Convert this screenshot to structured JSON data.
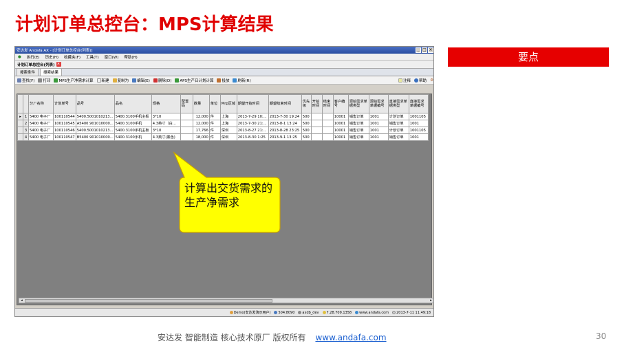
{
  "slide": {
    "title": "计划订单总控台：MPS计算结果",
    "keypoint_label": "要点",
    "callout_text": "计算出交货需求的生产净需求",
    "footer_text": "安达发   智能制造 核心技术原厂    版权所有",
    "footer_link": "www.andafa.com",
    "page_number": "30"
  },
  "window": {
    "title": "安达发 Andafa AX - [计划订单总控台(列表)]",
    "menu": [
      "执行(E)",
      "历史(H)",
      "收藏夹(F)",
      "工具(T)",
      "窗口(W)",
      "帮助(H)"
    ],
    "doc_tab": "计划订单总控台(列表)",
    "sub_tabs": [
      "搜索条件",
      "搜索结果"
    ],
    "toolbar": [
      "查找(F)",
      "打印",
      "MPS生产净需求计算",
      "新建",
      "复制为",
      "编辑(E)",
      "删除(D)",
      "APS生产日计划计算",
      "投放",
      "刷新(R)"
    ],
    "toolbar_right": [
      "注释",
      "帮助"
    ]
  },
  "grid": {
    "columns": [
      "分厂名称",
      "计划单号",
      "品号",
      "品名",
      "规格",
      "配置码",
      "数量",
      "单位",
      "Mrp区域",
      "期望开始时间",
      "期望结束时间",
      "优先级",
      "开始时间",
      "结束时间",
      "客户编号",
      "源始需求单据类型",
      "源始需求单据编号",
      "直接需求单据类型",
      "直接需求单据编号"
    ],
    "rows": [
      {
        "idx": "1",
        "cells": [
          "5400 电子厂",
          "100110544",
          "5400.5001010213...",
          "5400.3100手机主板",
          "3*10",
          "",
          "12,000",
          "件",
          "上海",
          "2013-7-29 10:...",
          "2013-7-30 19:24",
          "500",
          "",
          "",
          "10001",
          "销售订单",
          "1001",
          "计划订单",
          "1001105"
        ]
      },
      {
        "idx": "2",
        "cells": [
          "5400 电子厂",
          "100110545",
          "A5400.901010000...",
          "5400.3100手机",
          "4.3英寸（白...",
          "",
          "12,000",
          "件",
          "上海",
          "2013-7-30 21:...",
          "2013-8-1 13:24",
          "500",
          "",
          "",
          "10001",
          "销售订单",
          "1001",
          "销售订单",
          "1001"
        ]
      },
      {
        "idx": "3",
        "cells": [
          "5400 电子厂",
          "100110546",
          "5400.5001010213...",
          "5400.3100手机主板",
          "3*10",
          "",
          "17,766",
          "件",
          "深圳",
          "2013-8-27 21:...",
          "2013-8-28 23:25",
          "500",
          "",
          "",
          "10001",
          "销售订单",
          "1001",
          "计划订单",
          "1001105"
        ]
      },
      {
        "idx": "4",
        "cells": [
          "5400 电子厂",
          "100110547",
          "B5400.901010000...",
          "5400.3100手机",
          "4.3英寸(黑色)",
          "",
          "18,000",
          "件",
          "深圳",
          "2013-8-30 1:25",
          "2013-9-1 13:25",
          "500",
          "",
          "",
          "10001",
          "销售订单",
          "1001",
          "销售订单",
          "1001"
        ]
      }
    ]
  },
  "status_bar": [
    "Demo(安达发演示用户)",
    "504:8090",
    "axdb_dev",
    "7.28.709.1358",
    "www.andafa.com",
    "2013-7-11 11:49:18"
  ],
  "colors": {
    "title_red": "#e00000",
    "keypoint_bg": "#e60000",
    "callout_fill": "#ffff00",
    "callout_stroke": "#c8a000",
    "link_blue": "#1a5fd0"
  }
}
